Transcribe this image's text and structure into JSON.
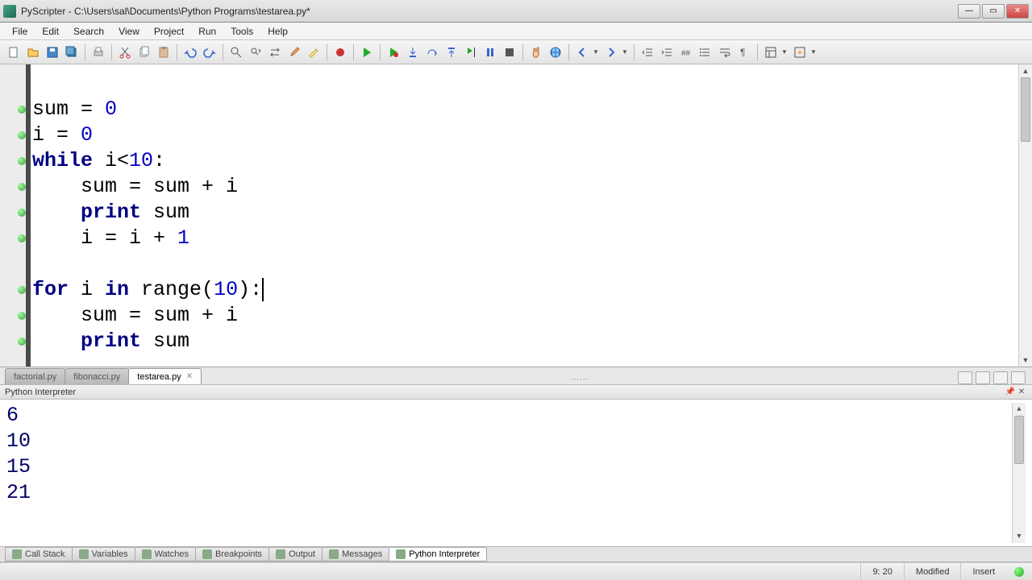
{
  "window": {
    "title": "PyScripter - C:\\Users\\sal\\Documents\\Python Programs\\testarea.py*"
  },
  "menu": {
    "items": [
      "File",
      "Edit",
      "Search",
      "View",
      "Project",
      "Run",
      "Tools",
      "Help"
    ]
  },
  "filetabs": {
    "tabs": [
      {
        "label": "factorial.py",
        "active": false
      },
      {
        "label": "fibonacci.py",
        "active": false
      },
      {
        "label": "testarea.py",
        "active": true
      }
    ]
  },
  "editor": {
    "lines": [
      {
        "text": "",
        "markers": false
      },
      {
        "text": "sum = 0",
        "markers": true,
        "tokens": [
          [
            "id",
            "sum"
          ],
          [
            "op",
            " = "
          ],
          [
            "num",
            "0"
          ]
        ]
      },
      {
        "text": "i = 0",
        "markers": true,
        "tokens": [
          [
            "id",
            "i"
          ],
          [
            "op",
            " = "
          ],
          [
            "num",
            "0"
          ]
        ]
      },
      {
        "text": "while i<10:",
        "markers": true,
        "tokens": [
          [
            "kw",
            "while"
          ],
          [
            "op",
            " i<"
          ],
          [
            "num",
            "10"
          ],
          [
            "op",
            ":"
          ]
        ]
      },
      {
        "text": "    sum = sum + i",
        "markers": true,
        "tokens": [
          [
            "op",
            "    sum = sum + i"
          ]
        ]
      },
      {
        "text": "    print sum",
        "markers": true,
        "tokens": [
          [
            "op",
            "    "
          ],
          [
            "kw",
            "print"
          ],
          [
            "op",
            " sum"
          ]
        ]
      },
      {
        "text": "    i = i + 1",
        "markers": true,
        "tokens": [
          [
            "op",
            "    i = i + "
          ],
          [
            "num",
            "1"
          ]
        ]
      },
      {
        "text": "",
        "markers": false
      },
      {
        "text": "for i in range(10):",
        "markers": true,
        "caret_after": true,
        "tokens": [
          [
            "kw",
            "for"
          ],
          [
            "op",
            " i "
          ],
          [
            "kw",
            "in"
          ],
          [
            "op",
            " range("
          ],
          [
            "num",
            "10"
          ],
          [
            "op",
            "):"
          ]
        ]
      },
      {
        "text": "    sum = sum + i",
        "markers": true,
        "tokens": [
          [
            "op",
            "    sum = sum + i"
          ]
        ]
      },
      {
        "text": "    print sum",
        "markers": true,
        "tokens": [
          [
            "op",
            "    "
          ],
          [
            "kw",
            "print"
          ],
          [
            "op",
            " sum"
          ]
        ]
      }
    ]
  },
  "interpreter_panel": {
    "title": "Python Interpreter",
    "output": [
      "6",
      "10",
      "15",
      "21"
    ]
  },
  "bottom_tabs": {
    "items": [
      "Call Stack",
      "Variables",
      "Watches",
      "Breakpoints",
      "Output",
      "Messages",
      "Python Interpreter"
    ],
    "active_index": 6
  },
  "status": {
    "cursor": "9: 20",
    "modified": "Modified",
    "mode": "Insert"
  }
}
